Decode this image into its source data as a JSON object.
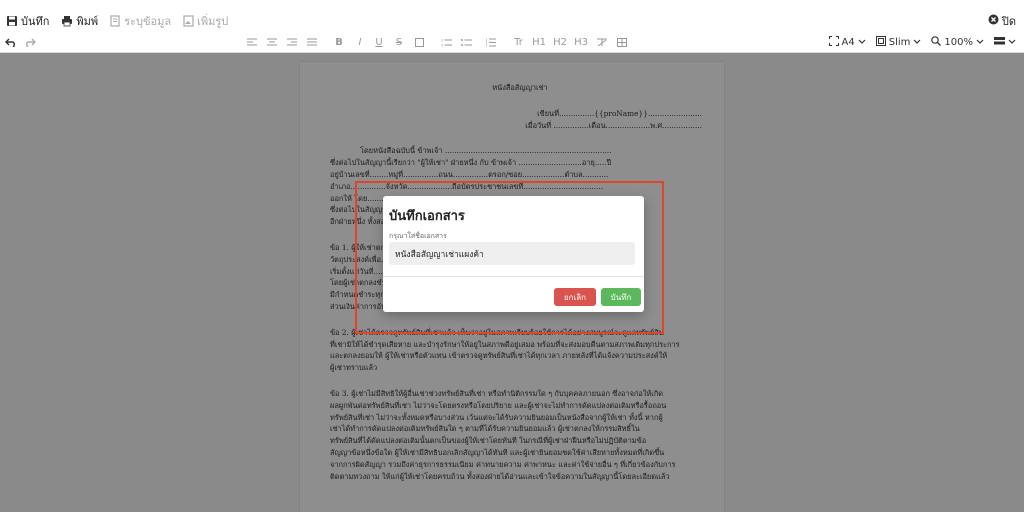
{
  "toolbar": {
    "save_label": "บันทึก",
    "print_label": "พิมพ์",
    "specify_data_label": "ระบุข้อมูล",
    "add_image_label": "เพิ่มรูป",
    "close_label": "ปิด",
    "heading_buttons": [
      "H1",
      "H2",
      "H3"
    ],
    "page_size": "A4",
    "margin_style": "Slim",
    "zoom": "100%"
  },
  "document": {
    "title": "หนังสือสัญญาเช่า",
    "lines": [
      "เขียนที่...............{{proName}}.......................",
      "เมื่อวันที่ ...............เดือน...................พ.ศ.................",
      "โดยหนังสือฉบับนี้ ข้าพเจ้า .......................................................................",
      "ซึ่งต่อไปในสัญญานี้เรียกว่า \"ผู้ให้เช่า\" ฝ่ายหนึ่ง กับ ข้าพเจ้า ...........................อายุ.....ปี",
      "อยู่บ้านเลขที่........หมู่ที่...............ถนน...............ตรอก/ซอย..................ตำบล...........",
      "อำเภอ...............จังหวัด...................ถือบัตรประชาชนเลขที่..................................",
      "ออกให้ โดย...........................................................................................",
      "ซึ่งต่อไปในสัญญานี้เรียกว่า \"ผู้เช่า\" อีกฝ่ายหนึ่ง",
      "อีกฝ่ายหนึ่ง ทั้งสองฝ่ายตกลงทำสัญญากันดังต่อไปนี้",
      "ข้อ 1. ผู้ให้เช่าตกลงให้เช่า และผู้เช่าตกลงเช่าทรัพย์สินดังรายการต่อไปนี้............................มี",
      "วัตถุประสงค์เพื่อ..........................................................................................",
      "เริ่มตั้งแต่วันที่...............................ถึงวันที่........................................",
      "โดยผู้เช่าตกลงชำระค่าเช่าเป็นเงิน...........................บาท (..................................)",
      "มีกำหนดชำระทุกวันที่..........ของเดือน",
      "ส่วนเงินค่าการอันเกิดจากทรัพย์สินที่เช่านี้ ให้.......................................เป็นผู้เสีย",
      "ข้อ 2. ผู้เช่าได้ตรวจดูทรัพย์สินที่เช่าแล้ว เห็นว่าอยู่ในสภาพเรียบร้อยใช้การได้อย่างสมบูรณ์จะดูแลทรัพย์สิน",
      "ที่เช่ามิให้ได้ชำรุดเสียหาย และบำรุงรักษาให้อยู่ในสภาพดีอยู่เสมอ พร้อมที่จะส่งมอบคืนตามสภาพเดิมทุกประการ",
      "และตกลงยอมให้ ผู้ให้เช่าหรือตัวแทน เข้าตรวจดูทรัพย์สินที่เช่าได้ทุกเวลา ภายหลังที่ได้แจ้งความประสงค์ให้",
      "ผู้เช่าทราบแล้ว",
      "ข้อ 3. ผู้เช่าไม่มีสิทธิให้ผู้อื่นเช่าช่วงทรัพย์สินที่เช่า หรือทำนิติกรรมใด ๆ กับบุคคลภายนอก ซึ่งอาจก่อให้เกิด",
      "ผลผูกพันต่อทรัพย์สินที่เช่า ไม่ว่าจะโดยตรงหรือโดยปริยาย และผู้เช่าจะไม่ทำการดัดแปลงต่อเติมหรือรื้อถอน",
      "ทรัพย์สินที่เช่า ไม่ว่าจะทั้งหมดหรือบางส่วน เว้นแต่จะได้รับความยินยอมเป็นหนังสือจากผู้ให้เช่า ทั้งนี้ หากผู้",
      "เช่าได้ทำการดัดแปลงต่อเติมทรัพย์สินใด ๆ ตามที่ได้รับความยินยอมแล้ว ผู้เช่าตกลงให้กรรมสิทธิ์ใน",
      "ทรัพย์สินที่ได้ดัดแปลงต่อเติมนั้นตกเป็นของผู้ให้เช่าโดยทันที ในกรณีที่ผู้เช่าฝ่าฝืนหรือไม่ปฏิบัติตามข้อ",
      "สัญญาข้อหนึ่งข้อใด ผู้ให้เช่ามีสิทธิบอกเลิกสัญญาได้ทันที และผู้เช่ายินยอมชดใช้ค่าเสียหายทั้งหมดที่เกิดขึ้น",
      "จากการผิดสัญญา รวมถึงค่าธุรการธรรมเนียม ค่าทนายความ ค่าพาหนะ และค่าใช้จ่ายอื่น ๆ ที่เกี่ยวข้องกับการ",
      "ติดตามทวงถาม ให้แก่ผู้ให้เช่าโดยครบถ้วน ทั้งสองฝ่ายได้อ่านและเข้าใจข้อความในสัญญานี้โดยละเอียดแล้ว"
    ]
  },
  "modal": {
    "title": "บันทึกเอกสาร",
    "field_label": "กรุณาใส่ชื่อเอกสาร",
    "field_value": "หนังสือสัญญาเช่าแผงค้า",
    "cancel_label": "ยกเลิก",
    "save_label": "บันทึก"
  },
  "colors": {
    "highlight_border": "#e0442a",
    "cancel_button": "#d9534f",
    "save_button": "#5cb85c",
    "overlay": "#8a8a8a"
  }
}
